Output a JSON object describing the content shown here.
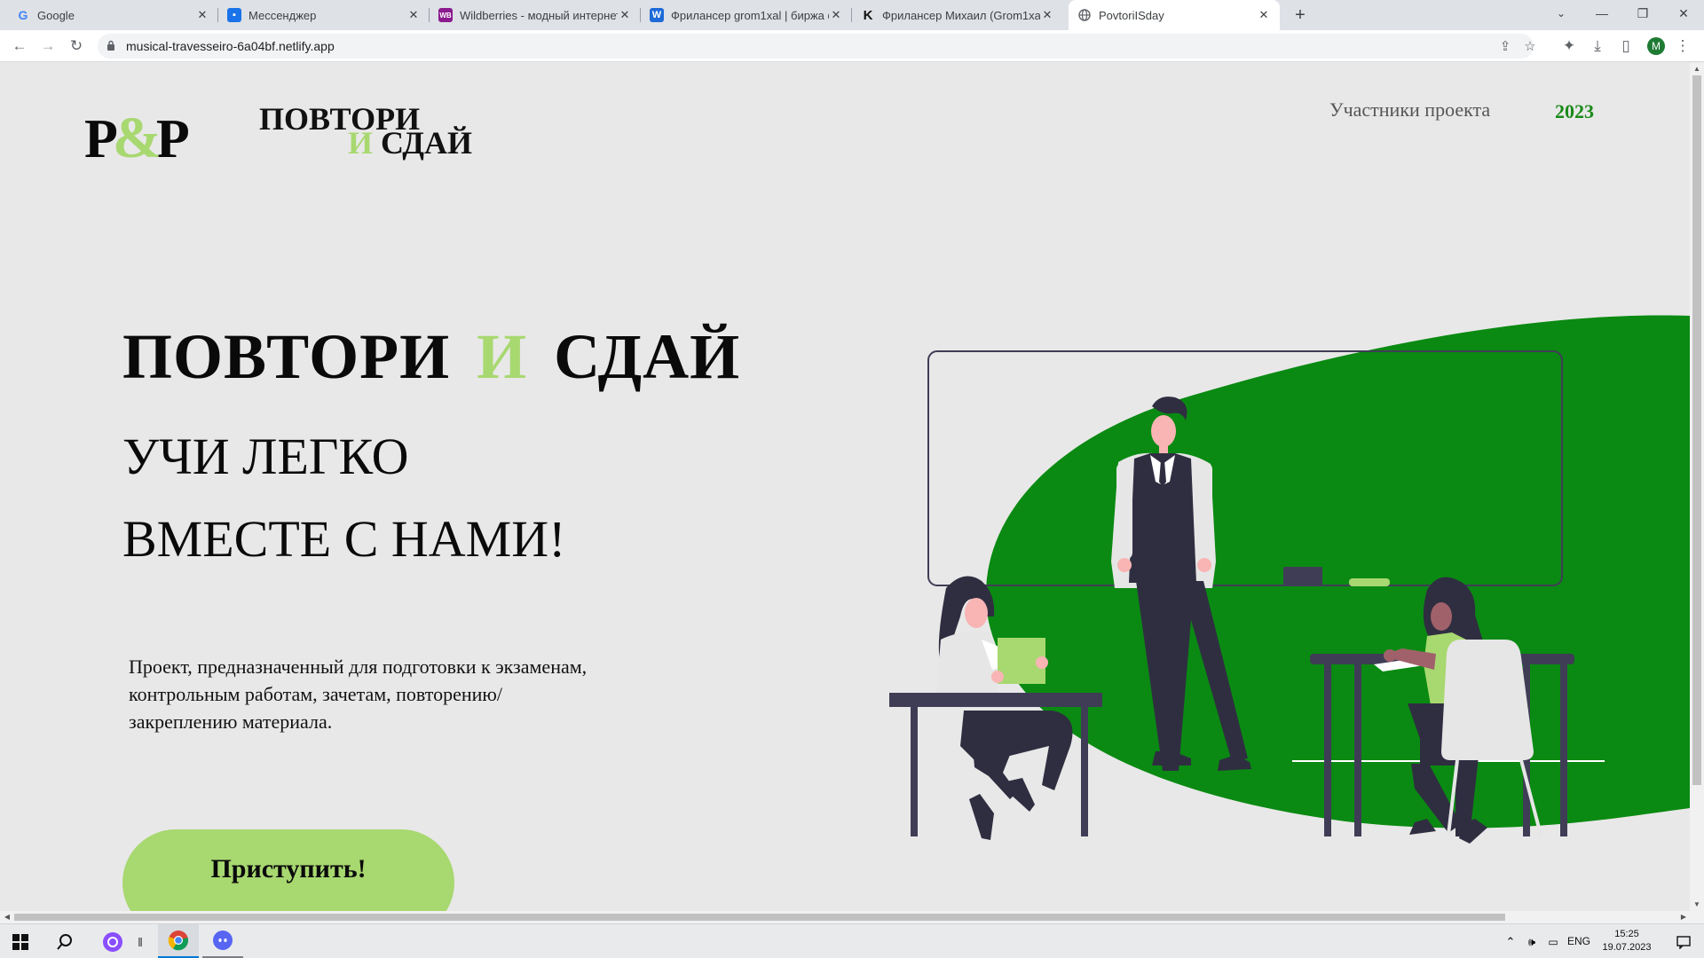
{
  "browser": {
    "tabs": [
      {
        "title": "Google",
        "icon": "google-icon",
        "icon_color": "#4285f4",
        "active": false
      },
      {
        "title": "Мессенджер",
        "icon": "messenger-icon",
        "icon_color": "#1a73e8",
        "active": false
      },
      {
        "title": "Wildberries - модный интернет",
        "icon": "wildberries-icon",
        "icon_color": "#8b1a8f",
        "active": false
      },
      {
        "title": "Фрилансер grom1xal | биржа ф",
        "icon": "weblancer-icon",
        "icon_color": "#1d6ad8",
        "active": false
      },
      {
        "title": "Фрилансер Михаил (Grom1xal) |",
        "icon": "kwork-icon",
        "icon_color": "#111111",
        "active": false
      },
      {
        "title": "PovtoriISday",
        "icon": "globe-icon",
        "icon_color": "#5f6368",
        "active": true
      }
    ],
    "url": "musical-travesseiro-6a04bf.netlify.app",
    "profile_initial": "M"
  },
  "site": {
    "logo": {
      "p": "P",
      "amp": "&",
      "p2": "P"
    },
    "brand": {
      "line1": "ПОВТОРИ",
      "and": "И",
      "line2": "СДАЙ"
    },
    "nav": {
      "members": "Участники проекта",
      "year": "2023"
    },
    "hero": {
      "title_part1": "ПОВТОРИ",
      "title_and": "И",
      "title_part2": "СДАЙ",
      "subtitle1": "УЧИ ЛЕГКО",
      "subtitle2": "ВМЕСТЕ С НАМИ!",
      "description": "Проект, предназначенный для подготовки к экзаменам, контрольным работам, зачетам, повторению/закреплению материала.",
      "cta_label": "Приступить!"
    },
    "colors": {
      "accent_green": "#a8d870",
      "dark_green": "#0a8a12",
      "background": "#e8e8e8"
    }
  },
  "taskbar": {
    "lang": "ENG",
    "time": "15:25",
    "date": "19.07.2023"
  }
}
